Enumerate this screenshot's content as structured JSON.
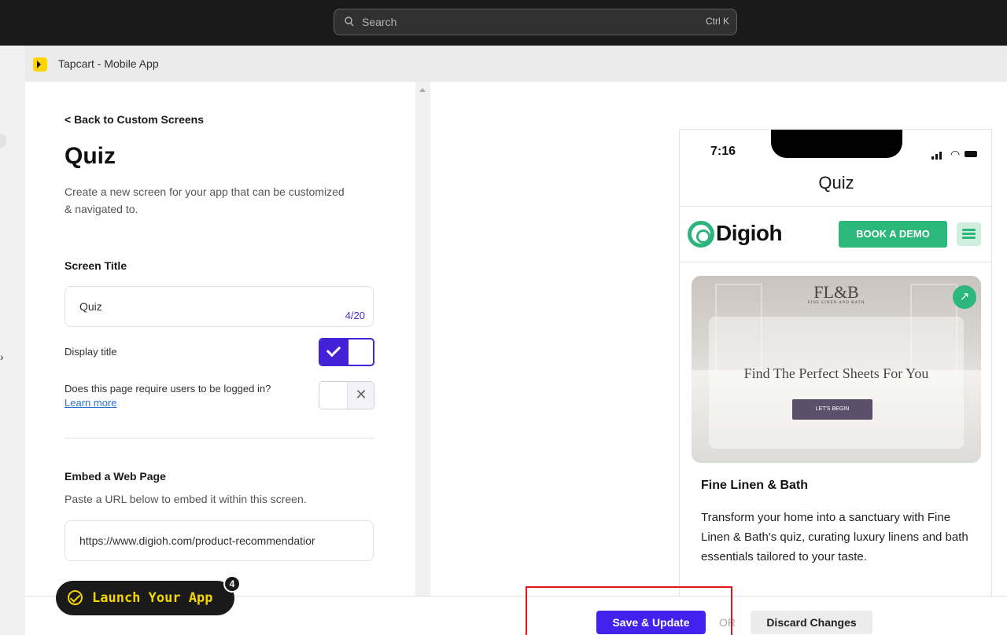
{
  "topbar": {
    "search_placeholder": "Search",
    "search_shortcut": "Ctrl K"
  },
  "app": {
    "title": "Tapcart - Mobile App"
  },
  "editor": {
    "back_link": "< Back to Custom Screens",
    "title": "Quiz",
    "description": "Create a new screen for your app that can be customized & navigated to.",
    "screen_title_label": "Screen Title",
    "screen_title_value": "Quiz",
    "screen_title_counter": "4/20",
    "display_title_label": "Display title",
    "display_title_enabled": true,
    "login_required_label": "Does this page require users to be logged in?",
    "login_required_enabled": false,
    "learn_more": "Learn more",
    "embed_label": "Embed a Web Page",
    "embed_help": "Paste a URL below to embed it within this screen.",
    "embed_url": "https://www.digioh.com/product-recommendatior"
  },
  "preview": {
    "status_time": "7:16",
    "screen_title": "Quiz",
    "site_logo": "Digioh",
    "cta": "BOOK A DEMO",
    "hero_brand": "FL&B",
    "hero_brand_sub": "FINE LINEN AND BATH",
    "hero_heading": "Find The Perfect Sheets For You",
    "hero_button": "LET'S BEGIN",
    "card_title": "Fine Linen & Bath",
    "card_description": "Transform your home into a sanctuary with Fine Linen & Bath's quiz, curating luxury linens and bath essentials tailored to your taste."
  },
  "footer": {
    "save": "Save & Update",
    "or": "OR",
    "discard": "Discard Changes",
    "launch": "Launch Your App",
    "launch_badge": "4"
  },
  "colors": {
    "primary": "#4322f0",
    "brand_green": "#2cb77b",
    "launch_yellow": "#f5d500",
    "highlight": "#e3131b"
  }
}
